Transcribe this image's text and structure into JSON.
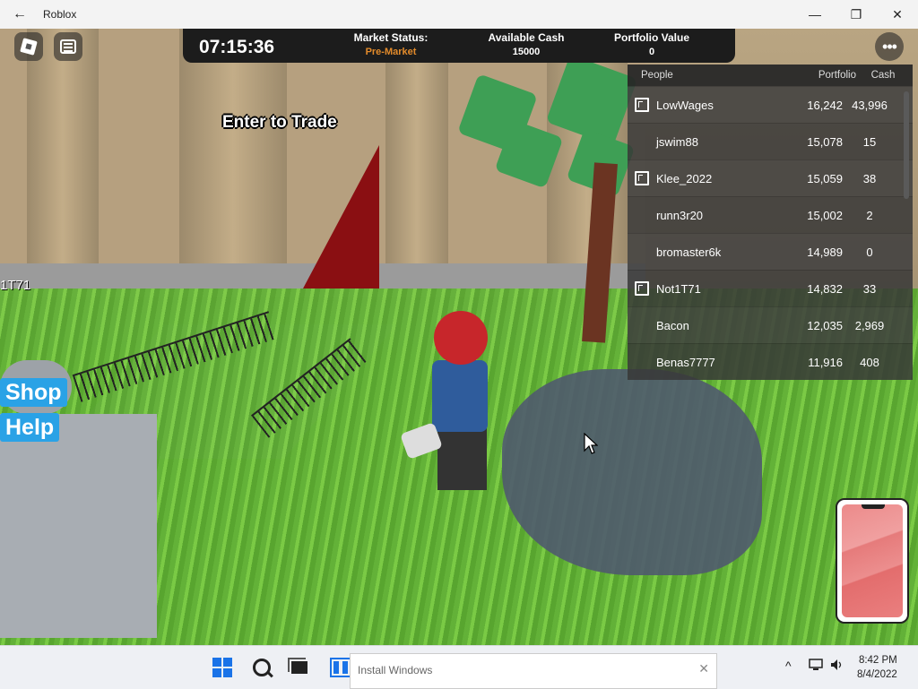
{
  "window": {
    "title": "Roblox",
    "back_glyph": "←",
    "minimize_glyph": "—",
    "maximize_glyph": "❐",
    "close_glyph": "✕"
  },
  "hud": {
    "clock": "07:15:36",
    "market_status_label": "Market Status:",
    "market_status_value": "Pre-Market",
    "available_cash_label": "Available Cash",
    "available_cash_value": "15000",
    "portfolio_value_label": "Portfolio Value",
    "portfolio_value_value": "0",
    "menu_glyph": "•••"
  },
  "world": {
    "enter_trade_sign": "Enter to Trade",
    "side_label": "1T71"
  },
  "leaderboard": {
    "headers": {
      "people": "People",
      "portfolio": "Portfolio",
      "cash": "Cash"
    },
    "rows": [
      {
        "name": "LowWages",
        "portfolio": "16,242",
        "cash": "43,996",
        "premium": true
      },
      {
        "name": "jswim88",
        "portfolio": "15,078",
        "cash": "15",
        "premium": false
      },
      {
        "name": "Klee_2022",
        "portfolio": "15,059",
        "cash": "38",
        "premium": true
      },
      {
        "name": "runn3r20",
        "portfolio": "15,002",
        "cash": "2",
        "premium": false
      },
      {
        "name": "bromaster6k",
        "portfolio": "14,989",
        "cash": "0",
        "premium": false
      },
      {
        "name": "Not1T71",
        "portfolio": "14,832",
        "cash": "33",
        "premium": true
      },
      {
        "name": "Bacon",
        "portfolio": "12,035",
        "cash": "2,969",
        "premium": false
      },
      {
        "name": "Benas7777",
        "portfolio": "11,916",
        "cash": "408",
        "premium": false
      }
    ]
  },
  "buttons": {
    "shop": "Shop",
    "help": "Help"
  },
  "taskbar": {
    "install_placeholder": "Install Windows",
    "install_close": "✕",
    "time": "8:42 PM",
    "date": "8/4/2022",
    "tray_chevron": "^",
    "tray_volume": "🔊"
  },
  "colors": {
    "accent": "#2aa2e6",
    "pre_market": "#e38b2b",
    "hud_bg": "#1c1c1c"
  }
}
